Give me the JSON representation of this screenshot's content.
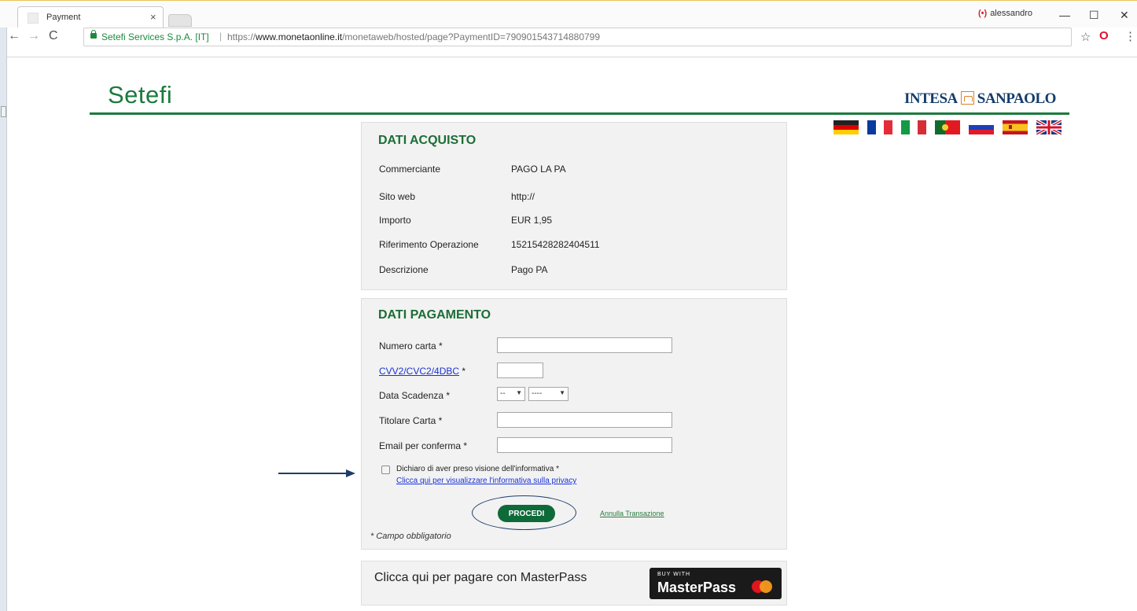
{
  "browser": {
    "tab_title": "Payment",
    "tab_close": "×",
    "profile_name": "alessandro",
    "profile_icon": "(•)",
    "window_minimize": "—",
    "window_maximize": "☐",
    "window_close": "✕",
    "nav_back": "←",
    "nav_forward": "→",
    "nav_reload": "C",
    "site_identity": "Setefi Services S.p.A. [IT]",
    "url_prefix": "https://",
    "url_host": "www.monetaonline.it",
    "url_path": "/monetaweb/hosted/page?PaymentID=790901543714880799",
    "separator": "|",
    "bookmark_icon": "☆",
    "extension_icon": "O",
    "menu_icon": "⋮"
  },
  "header": {
    "brand": "Setefi",
    "bank_name_left": "INTESA",
    "bank_name_right": "SANPAOLO",
    "accent_color": "#1c7a3d",
    "languages": [
      "German",
      "French",
      "Italian",
      "Portuguese",
      "Russian",
      "Spanish",
      "English"
    ]
  },
  "purchase": {
    "title": "DATI ACQUISTO",
    "rows": [
      {
        "label": "Commerciante",
        "value": "PAGO LA PA"
      },
      {
        "label": "Sito web",
        "value": "http://"
      },
      {
        "label": "Importo",
        "value": "EUR 1,95"
      },
      {
        "label": "Riferimento Operazione",
        "value": "15215428282404511"
      },
      {
        "label": "Descrizione",
        "value": "Pago PA"
      }
    ]
  },
  "payment": {
    "title": "DATI PAGAMENTO",
    "card_number_label": "Numero carta *",
    "cvv_link": "CVV2/CVC2/4DBC",
    "cvv_required": " *",
    "expiry_label": "Data Scadenza *",
    "expiry_month": "--",
    "expiry_year": "----",
    "select_arrow": "▼",
    "holder_label": "Titolare Carta *",
    "email_label": "Email per conferma *",
    "consent_text": "Dichiaro di aver preso visione dell'informativa *",
    "privacy_link": "Clicca qui per visualizzare l'informativa sulla privacy",
    "submit_label": "PROCEDI",
    "cancel_label": "Annulla Transazione",
    "required_note": "* Campo obbligatorio"
  },
  "masterpass": {
    "text": "Clicca qui per pagare con MasterPass",
    "button_small": "BUY WITH",
    "button_big": "MasterPass"
  }
}
